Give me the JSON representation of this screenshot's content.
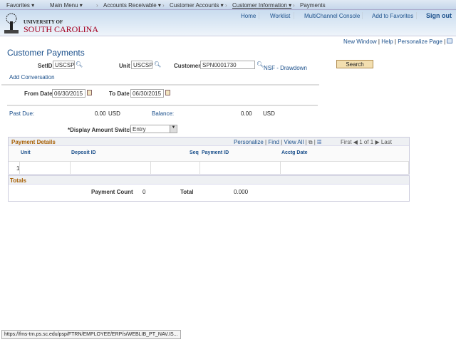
{
  "navbar": {
    "favorites": "Favorites ▾",
    "main_menu": "Main Menu ▾",
    "breadcrumbs": [
      "Accounts Receivable ▾",
      "Customer Accounts ▾",
      "Customer Information ▾",
      "Payments"
    ]
  },
  "header": {
    "logo_top": "UNIVERSITY OF",
    "logo_bottom": "SOUTH CAROLINA",
    "links": [
      "Home",
      "Worklist",
      "MultiChannel Console",
      "Add to Favorites"
    ],
    "signout": "Sign out"
  },
  "pagebar": {
    "new_window": "New Window",
    "help": "Help",
    "personalize": "Personalize Page"
  },
  "page": {
    "title": "Customer Payments",
    "setid_label": "SetID",
    "setid": "USCSP",
    "unit_label": "Unit",
    "unit": "USCSP",
    "customer_label": "Customer",
    "customer": "SPN0001730",
    "customer_name": "NSF - Drawdown",
    "search": "Search",
    "add_conversation": "Add Conversation",
    "from_label": "From Date",
    "from": "06/30/2015",
    "to_label": "To Date",
    "to": "06/30/2015",
    "past_due_label": "Past Due:",
    "past_due": "0.00",
    "past_due_cur": "USD",
    "balance_label": "Balance:",
    "balance": "0.00",
    "balance_cur": "USD",
    "switch_label": "*Display Amount Switch",
    "switch_value": "Entry"
  },
  "grid": {
    "title": "Payment Details",
    "personalize": "Personalize",
    "find": "Find",
    "view_all": "View All",
    "first": "First",
    "range": "1 of 1",
    "last": "Last",
    "columns": [
      "Unit",
      "Deposit ID",
      "Seq",
      "Payment ID",
      "Acctg Date"
    ],
    "row_num": "1"
  },
  "totals": {
    "title": "Totals",
    "count_label": "Payment Count",
    "count": "0",
    "total_label": "Total",
    "total": "0.000"
  },
  "status": {
    "url": "https://fms-trn.ps.sc.edu/psp/FTRN/EMPLOYEE/ERP/s/WEBLIB_PT_NAV.IS..."
  }
}
